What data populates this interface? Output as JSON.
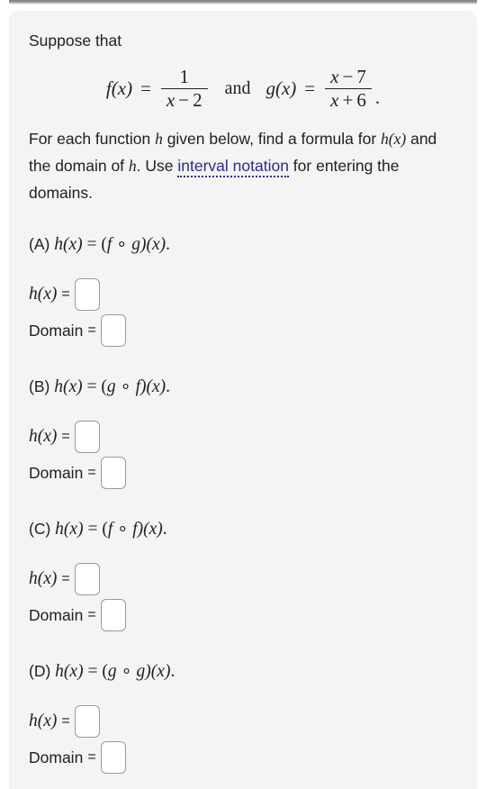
{
  "page": {
    "card_background": "#f4f4f4",
    "link_color": "#2b2b8f",
    "text_color": "#1f1f1f"
  },
  "problem": {
    "lead": "Suppose that",
    "equation": {
      "f_name": "f",
      "f_arg": "(x)",
      "f_equals": "=",
      "f_numerator": "1",
      "f_denominator_var": "x",
      "f_denominator_op": "−",
      "f_denominator_num": "2",
      "conjunction": "and",
      "g_name": "g",
      "g_arg": "(x)",
      "g_equals": "=",
      "g_numerator_var": "x",
      "g_numerator_op": "−",
      "g_numerator_num": "7",
      "g_denominator_var": "x",
      "g_denominator_op": "+",
      "g_denominator_num": "6",
      "trailing_period": "."
    },
    "instructions": {
      "segment_1": "For each function ",
      "var_h_1": "h",
      "segment_2": " given below, find a formula for ",
      "var_hx": "h(x)",
      "segment_3": " and the domain of ",
      "var_h_2": "h",
      "segment_4": ". Use ",
      "link_text": "interval notation",
      "segment_5": " for entering the domains."
    }
  },
  "parts": [
    {
      "label": "(A)",
      "statement_lhs": "h(x)",
      "statement_eq": "=",
      "statement_rhs_open": "(",
      "statement_first": "f",
      "statement_ring": "∘",
      "statement_second": "g",
      "statement_rhs_close": ")(x)",
      "statement_period": ".",
      "hx_label_math": "h(x)",
      "hx_equals": "=",
      "hx_value": "",
      "hx_placeholder": "",
      "domain_label": "Domain",
      "domain_equals": "=",
      "domain_value": "",
      "domain_placeholder": ""
    },
    {
      "label": "(B)",
      "statement_lhs": "h(x)",
      "statement_eq": "=",
      "statement_rhs_open": "(",
      "statement_first": "g",
      "statement_ring": "∘",
      "statement_second": "f",
      "statement_rhs_close": ")(x)",
      "statement_period": ".",
      "hx_label_math": "h(x)",
      "hx_equals": "=",
      "hx_value": "",
      "hx_placeholder": "",
      "domain_label": "Domain",
      "domain_equals": "=",
      "domain_value": "",
      "domain_placeholder": ""
    },
    {
      "label": "(C)",
      "statement_lhs": "h(x)",
      "statement_eq": "=",
      "statement_rhs_open": "(",
      "statement_first": "f",
      "statement_ring": "∘",
      "statement_second": "f",
      "statement_rhs_close": ")(x)",
      "statement_period": ".",
      "hx_label_math": "h(x)",
      "hx_equals": "=",
      "hx_value": "",
      "hx_placeholder": "",
      "domain_label": "Domain",
      "domain_equals": "=",
      "domain_value": "",
      "domain_placeholder": ""
    },
    {
      "label": "(D)",
      "statement_lhs": "h(x)",
      "statement_eq": "=",
      "statement_rhs_open": "(",
      "statement_first": "g",
      "statement_ring": "∘",
      "statement_second": "g",
      "statement_rhs_close": ")(x)",
      "statement_period": ".",
      "hx_label_math": "h(x)",
      "hx_equals": "=",
      "hx_value": "",
      "hx_placeholder": "",
      "domain_label": "Domain",
      "domain_equals": "=",
      "domain_value": "",
      "domain_placeholder": ""
    }
  ]
}
